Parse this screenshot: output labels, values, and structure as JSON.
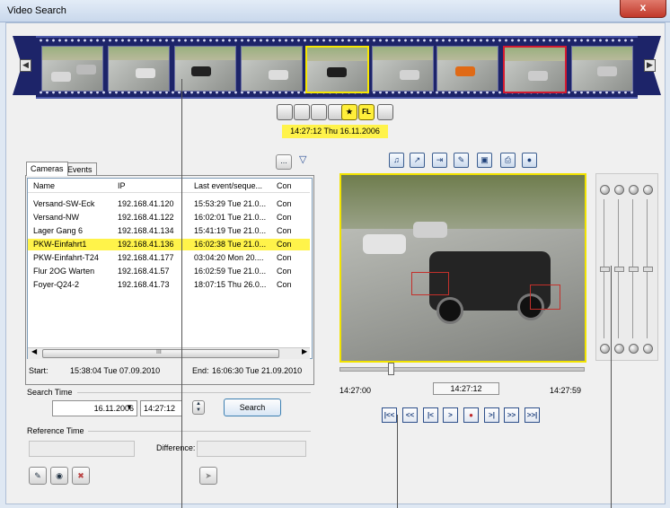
{
  "window": {
    "title": "Video Search",
    "close_label": "x"
  },
  "filmstrip": {
    "frames": 8,
    "selected_index": 4,
    "marked_index": 6
  },
  "time_display": "14:27:12 Thu 16.11.2006",
  "mode_buttons": [
    "",
    "",
    "",
    "",
    "FL"
  ],
  "tabs": [
    "Cameras",
    "Events"
  ],
  "list": {
    "columns": [
      "Name",
      "IP",
      "Last event/seque...",
      "Con"
    ],
    "rows": [
      {
        "name": "Versand-SW-Eck",
        "ip": "192.168.41.120",
        "last": "15:53:29 Tue 21.0...",
        "con": "Con"
      },
      {
        "name": "Versand-NW",
        "ip": "192.168.41.122",
        "last": "16:02:01 Tue 21.0...",
        "con": "Con"
      },
      {
        "name": "Lager Gang 6",
        "ip": "192.168.41.134",
        "last": "15:41:19 Tue 21.0...",
        "con": "Con"
      },
      {
        "name": "PKW-Einfahrt1",
        "ip": "192.168.41.136",
        "last": "16:02:38 Tue 21.0...",
        "con": "Con"
      },
      {
        "name": "PKW-Einfahrt-T24",
        "ip": "192.168.41.177",
        "last": "03:04:20 Mon 20....",
        "con": "Con"
      },
      {
        "name": "Flur 2OG Warten",
        "ip": "192.168.41.57",
        "last": "16:02:59 Tue 21.0...",
        "con": "Con"
      },
      {
        "name": "Foyer-Q24-2",
        "ip": "192.168.41.73",
        "last": "18:07:15 Thu 26.0...",
        "con": "Con"
      }
    ],
    "selected_row": 3,
    "scroll_mark": "III"
  },
  "range": {
    "start_label": "Start:",
    "start_value": "15:38:04 Tue 07.09.2010",
    "end_label": "End:",
    "end_value": "16:06:30 Tue 21.09.2010"
  },
  "search_time": {
    "group_label": "Search Time",
    "date": "16.11.2006",
    "time": "14:27:12",
    "search_label": "Search"
  },
  "reference_time": {
    "group_label": "Reference Time",
    "difference_label": "Difference:"
  },
  "list_toolbar": {
    "more_label": "...",
    "filter_icon": "filter-icon"
  },
  "timeline": {
    "start": "14:27:00",
    "current": "14:27:12",
    "end": "14:27:59"
  },
  "playback_buttons": [
    "|<<",
    "<<",
    "|<",
    ">",
    "rec",
    ">|",
    ">>",
    ">>|"
  ],
  "colors": {
    "highlight": "#fff34a",
    "selected_frame": "#f7e700",
    "marked_frame": "#d41a30",
    "film": "#1d2469"
  }
}
